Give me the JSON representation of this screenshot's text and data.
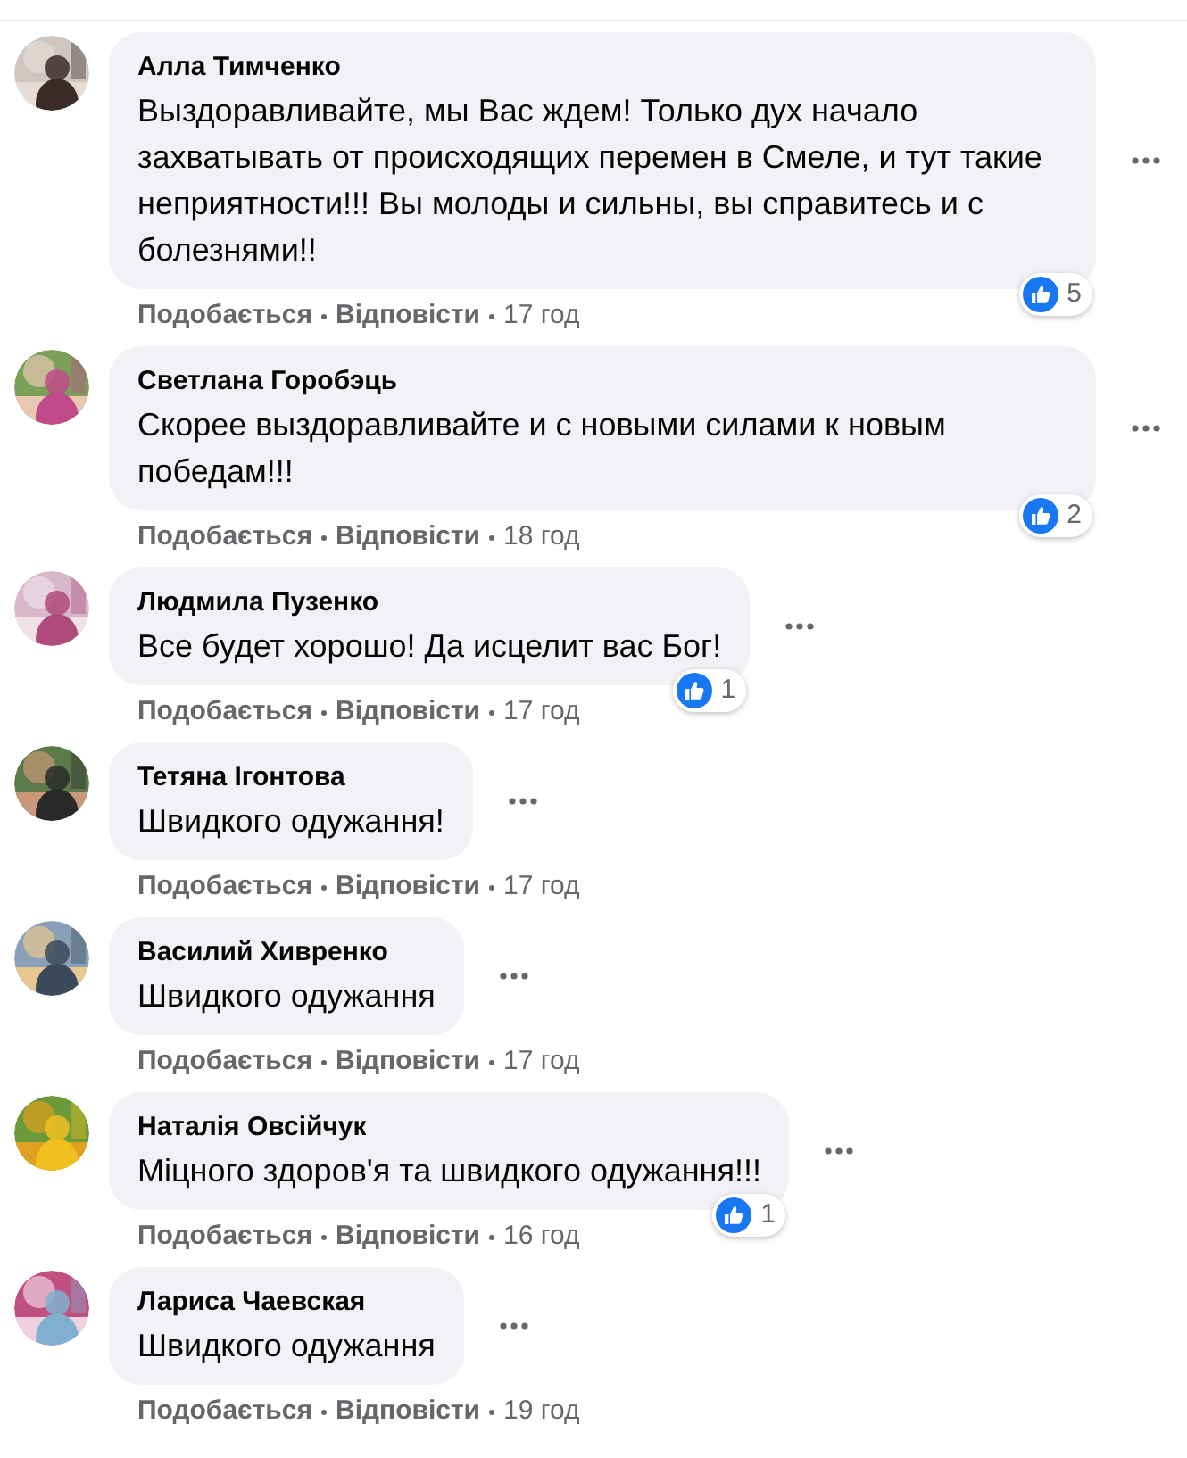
{
  "comments": [
    {
      "author": "Алла Тимченко",
      "text": "Выздоравливайте, мы Вас ждем! Только дух начало захватывать от происходящих перемен в Смеле, и тут такие неприятности!!! Вы молоды и сильны, вы справитесь и с болезнями!!",
      "likes": "5",
      "like_label": "Подобається",
      "reply_label": "Відповісти",
      "time": "17 год"
    },
    {
      "author": "Светлана Горобэць",
      "text": "Скорее выздоравливайте и с новыми силами к новым победам!!!",
      "likes": "2",
      "like_label": "Подобається",
      "reply_label": "Відповісти",
      "time": "18 год"
    },
    {
      "author": "Людмила Пузенко",
      "text": "Все будет хорошо! Да исцелит вас Бог!",
      "likes": "1",
      "like_label": "Подобається",
      "reply_label": "Відповісти",
      "time": "17 год"
    },
    {
      "author": "Тетяна Ігонтова",
      "text": "Швидкого одужання!",
      "like_label": "Подобається",
      "reply_label": "Відповісти",
      "time": "17 год"
    },
    {
      "author": "Василий Хивренко",
      "text": "Швидкого одужання",
      "like_label": "Подобається",
      "reply_label": "Відповісти",
      "time": "17 год"
    },
    {
      "author": "Наталія Овсійчук",
      "text": "Міцного здоров'я та швидкого одужання!!!",
      "likes": "1",
      "like_label": "Подобається",
      "reply_label": "Відповісти",
      "time": "16 год"
    },
    {
      "author": "Лариса Чаевская",
      "text": "Швидкого одужання",
      "like_label": "Подобається",
      "reply_label": "Відповісти",
      "time": "19 год"
    }
  ]
}
